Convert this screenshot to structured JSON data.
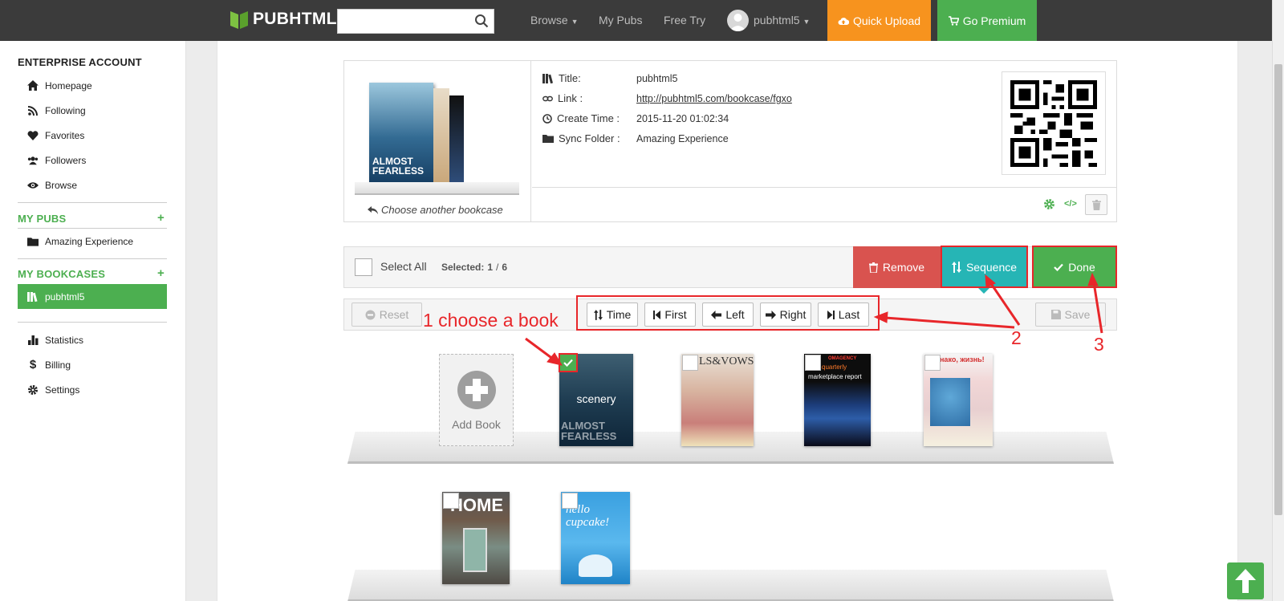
{
  "topbar": {
    "logo_text": "PUBHTML5",
    "search_placeholder": "",
    "nav": {
      "browse": "Browse",
      "my_pubs": "My Pubs",
      "free_try": "Free Try",
      "user": "pubhtml5"
    },
    "quick_upload": "Quick Upload",
    "go_premium": "Go Premium"
  },
  "sidebar": {
    "account_title": "ENTERPRISE ACCOUNT",
    "items": [
      "Homepage",
      "Following",
      "Favorites",
      "Followers",
      "Browse"
    ],
    "my_pubs_title": "MY PUBS",
    "my_pubs_items": [
      "Amazing Experience"
    ],
    "my_bookcases_title": "MY BOOKCASES",
    "bookcases": [
      "pubhtml5"
    ],
    "bottom_items": [
      "Statistics",
      "Billing",
      "Settings"
    ]
  },
  "bookcase": {
    "choose_another": "Choose another bookcase",
    "cover_title_line1": "ALMOST",
    "cover_title_line2": "FEARLESS",
    "labels": {
      "title": "Title:",
      "link": "Link :",
      "create_time": "Create Time :",
      "sync_folder": "Sync Folder :"
    },
    "values": {
      "title": "pubhtml5",
      "link": "http://pubhtml5.com/bookcase/fgxo",
      "create_time": "2015-11-20 01:02:34",
      "sync_folder": "Amazing Experience"
    }
  },
  "toolbar": {
    "select_all": "Select All",
    "selected_label": "Selected:",
    "selected_count": "1",
    "selected_sep": "/",
    "selected_total": "6",
    "remove": "Remove",
    "sequence": "Sequence",
    "done": "Done"
  },
  "sequence_bar": {
    "reset": "Reset",
    "time": "Time",
    "first": "First",
    "left": "Left",
    "right": "Right",
    "last": "Last",
    "save": "Save"
  },
  "books": {
    "add_book": "Add Book",
    "selected_book_label": "scenery",
    "book2_header": "LS&VOWS",
    "book3_header": "marketplace report",
    "book3_brand": "OMAGENCY",
    "book3_sub": "quarterly",
    "book4_header": "нако, жизнь!",
    "book5_header": "HOME",
    "book6_header": "hello cupcake!"
  },
  "annotations": {
    "step1": "1 choose a book",
    "step2": "2",
    "step3": "3"
  },
  "colors": {
    "green": "#4caf50",
    "orange": "#f7931e",
    "teal": "#26b5b5",
    "remove_red": "#d9534f",
    "annotation_red": "#e8262a",
    "topbar": "#3b3b3b"
  }
}
